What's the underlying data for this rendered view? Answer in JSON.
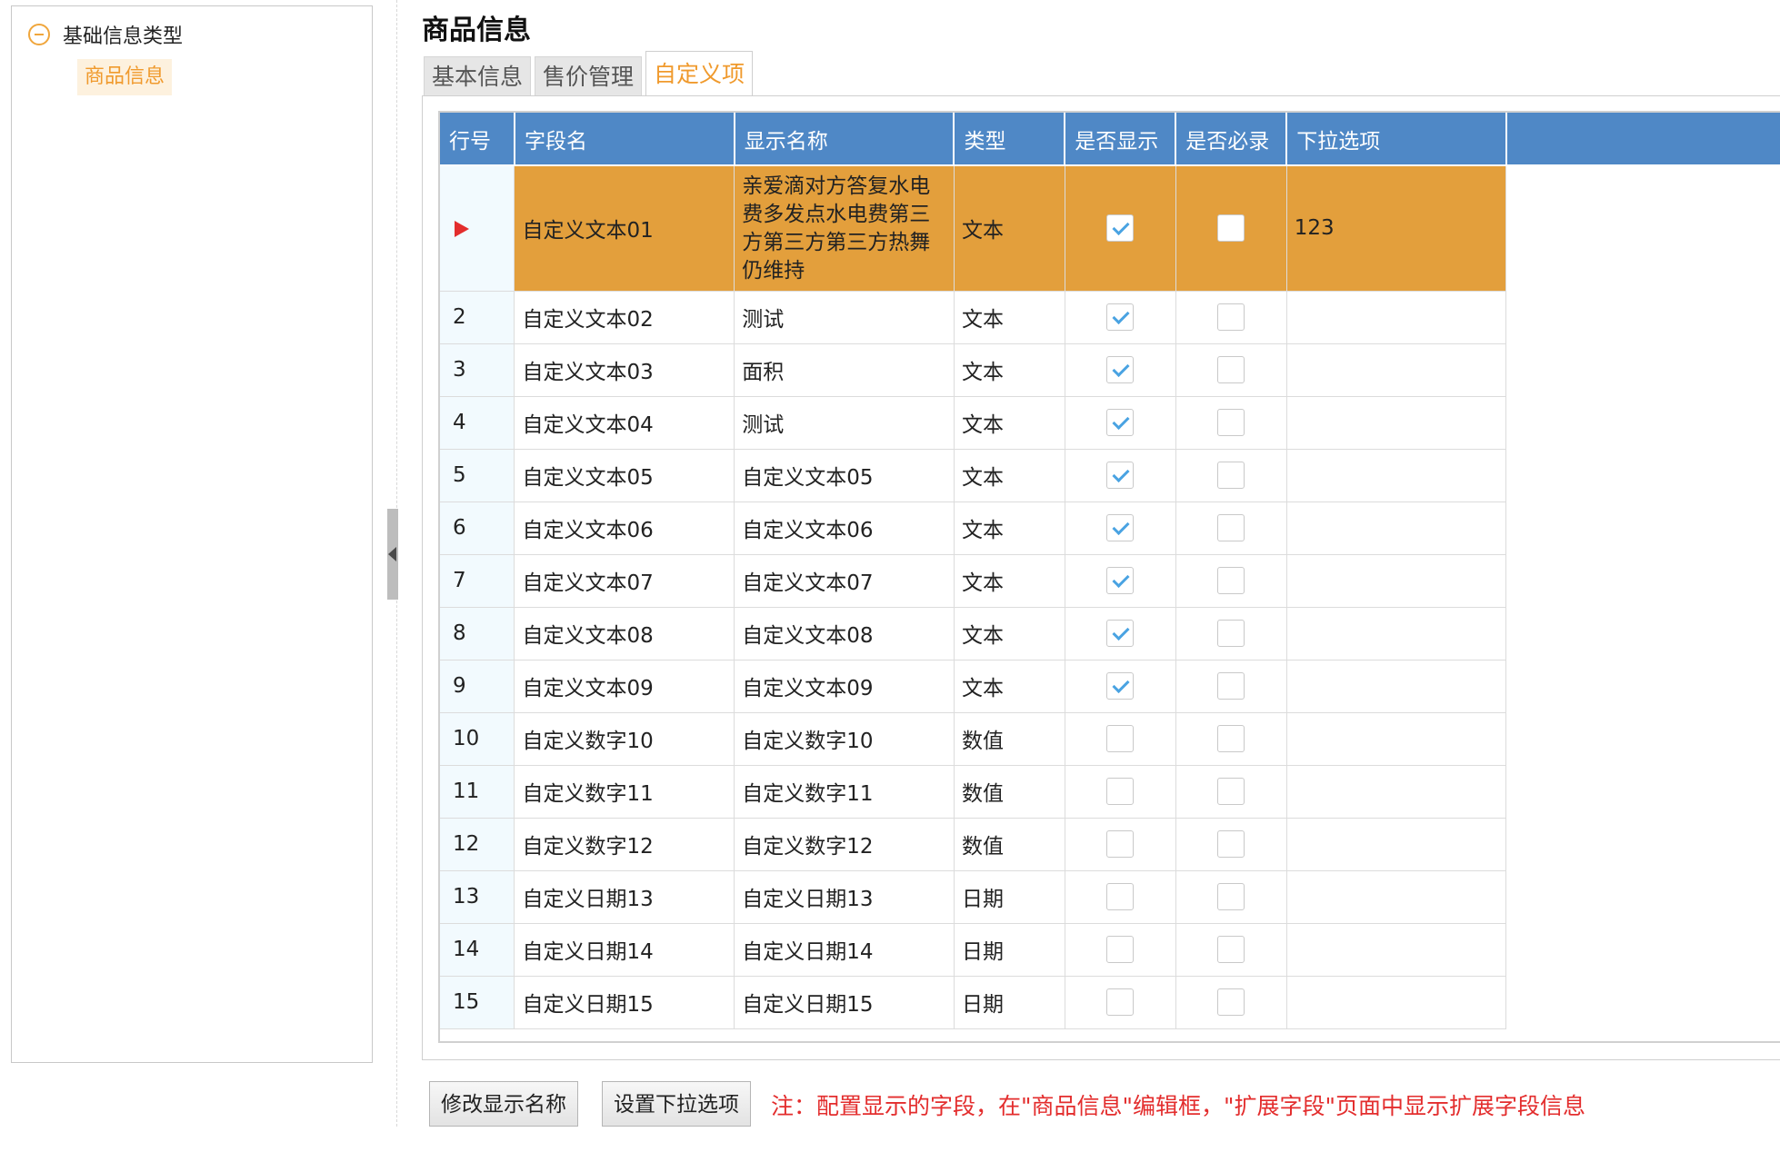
{
  "tree": {
    "root_label": "基础信息类型",
    "child_label": "商品信息"
  },
  "page_title": "商品信息",
  "tabs": [
    {
      "label": "基本信息",
      "active": false
    },
    {
      "label": "售价管理",
      "active": false
    },
    {
      "label": "自定义项",
      "active": true
    }
  ],
  "grid": {
    "columns": [
      "行号",
      "字段名",
      "显示名称",
      "类型",
      "是否显示",
      "是否必录",
      "下拉选项"
    ],
    "rows": [
      {
        "row": "",
        "field": "自定义文本01",
        "display": "亲爱滴对方答复水电费多发点水电费第三方第三方第三方热舞仍维持",
        "type": "文本",
        "show": true,
        "required": false,
        "options": "123",
        "selected": true
      },
      {
        "row": "2",
        "field": "自定义文本02",
        "display": "测试",
        "type": "文本",
        "show": true,
        "required": false,
        "options": ""
      },
      {
        "row": "3",
        "field": "自定义文本03",
        "display": "面积",
        "type": "文本",
        "show": true,
        "required": false,
        "options": ""
      },
      {
        "row": "4",
        "field": "自定义文本04",
        "display": "测试",
        "type": "文本",
        "show": true,
        "required": false,
        "options": ""
      },
      {
        "row": "5",
        "field": "自定义文本05",
        "display": "自定义文本05",
        "type": "文本",
        "show": true,
        "required": false,
        "options": ""
      },
      {
        "row": "6",
        "field": "自定义文本06",
        "display": "自定义文本06",
        "type": "文本",
        "show": true,
        "required": false,
        "options": ""
      },
      {
        "row": "7",
        "field": "自定义文本07",
        "display": "自定义文本07",
        "type": "文本",
        "show": true,
        "required": false,
        "options": ""
      },
      {
        "row": "8",
        "field": "自定义文本08",
        "display": "自定义文本08",
        "type": "文本",
        "show": true,
        "required": false,
        "options": ""
      },
      {
        "row": "9",
        "field": "自定义文本09",
        "display": "自定义文本09",
        "type": "文本",
        "show": true,
        "required": false,
        "options": ""
      },
      {
        "row": "10",
        "field": "自定义数字10",
        "display": "自定义数字10",
        "type": "数值",
        "show": false,
        "required": false,
        "options": ""
      },
      {
        "row": "11",
        "field": "自定义数字11",
        "display": "自定义数字11",
        "type": "数值",
        "show": false,
        "required": false,
        "options": ""
      },
      {
        "row": "12",
        "field": "自定义数字12",
        "display": "自定义数字12",
        "type": "数值",
        "show": false,
        "required": false,
        "options": ""
      },
      {
        "row": "13",
        "field": "自定义日期13",
        "display": "自定义日期13",
        "type": "日期",
        "show": false,
        "required": false,
        "options": ""
      },
      {
        "row": "14",
        "field": "自定义日期14",
        "display": "自定义日期14",
        "type": "日期",
        "show": false,
        "required": false,
        "options": ""
      },
      {
        "row": "15",
        "field": "自定义日期15",
        "display": "自定义日期15",
        "type": "日期",
        "show": false,
        "required": false,
        "options": ""
      }
    ]
  },
  "buttons": {
    "edit_display_name": "修改显示名称",
    "set_dropdown": "设置下拉选项"
  },
  "note": "注：配置显示的字段，在\"商品信息\"编辑框，\"扩展字段\"页面中显示扩展字段信息",
  "colors": {
    "header_bg": "#4f88c6",
    "selected_row": "#e39f3c",
    "accent": "#f09a2d",
    "note": "#e32d2d"
  }
}
